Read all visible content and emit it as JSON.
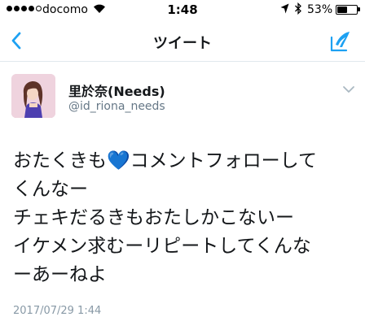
{
  "status_bar": {
    "signal_filled": 4,
    "signal_total": 5,
    "carrier": "docomo",
    "time": "1:48",
    "battery_percent": "53%",
    "battery_level": 0.53
  },
  "nav": {
    "title": "ツイート",
    "accent_color": "#1da1f2"
  },
  "tweet": {
    "display_name": "里於奈(Needs)",
    "handle": "@id_riona_needs",
    "lines": [
      "おたくきも💙コメントフォローして",
      "くんなー",
      "チェキだるきもおたしかこないー",
      "イケメン求むーリピートしてくんな",
      "ーあーねよ"
    ],
    "timestamp": "2017/07/29 1:44"
  }
}
